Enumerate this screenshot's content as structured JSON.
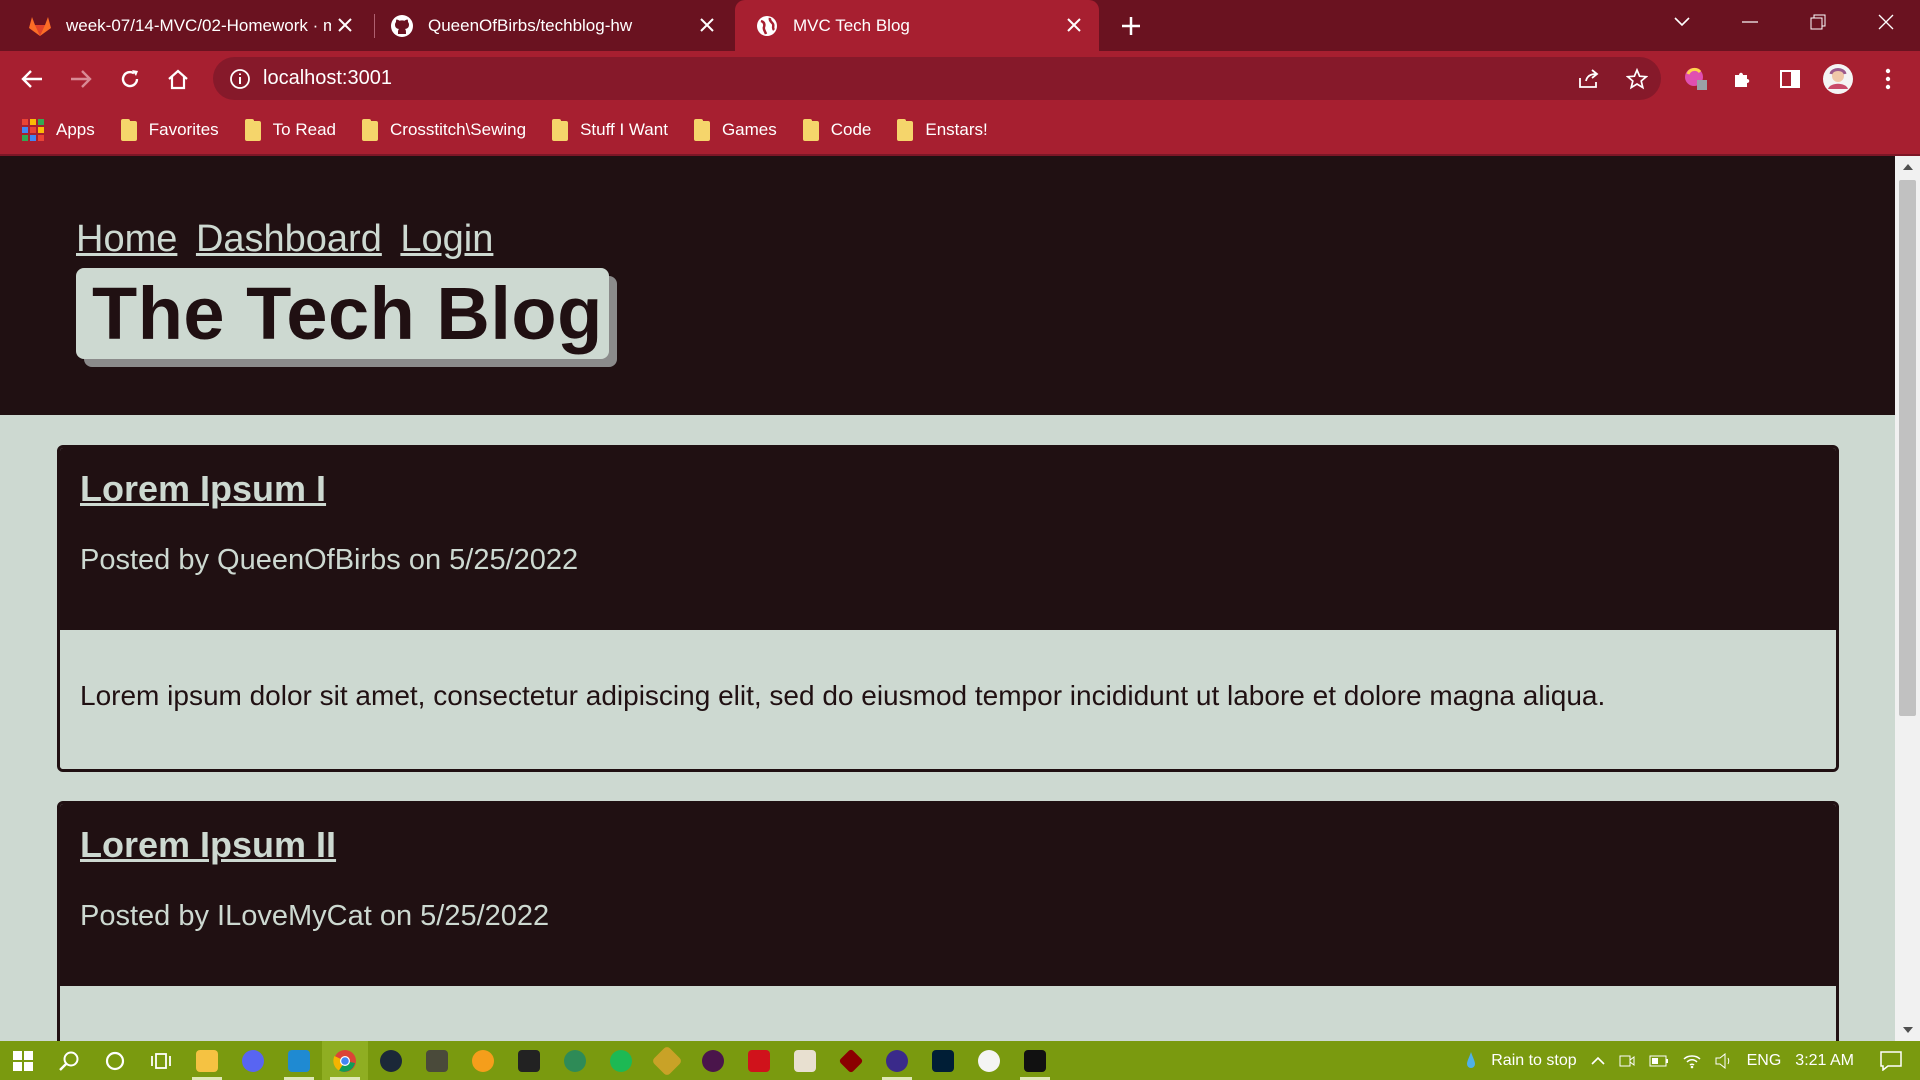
{
  "browser": {
    "tabs": [
      {
        "title": "week-07/14-MVC/02-Homework · m",
        "icon": "gitlab-icon",
        "active": false
      },
      {
        "title": "QueenOfBirbs/techblog-hw",
        "icon": "github-icon",
        "active": false
      },
      {
        "title": "MVC Tech Blog",
        "icon": "globe-icon",
        "active": true
      }
    ],
    "address": "localhost:3001",
    "bookmarks": [
      "Apps",
      "Favorites",
      "To Read",
      "Crosstitch\\Sewing",
      "Stuff I Want",
      "Games",
      "Code",
      "Enstars!"
    ]
  },
  "site": {
    "nav": {
      "home": "Home",
      "dashboard": "Dashboard",
      "login": "Login"
    },
    "brand": "The Tech Blog",
    "posts": [
      {
        "title": "Lorem Ipsum I",
        "meta": "Posted by QueenOfBirbs on 5/25/2022",
        "body": "Lorem ipsum dolor sit amet, consectetur adipiscing elit, sed do eiusmod tempor incididunt ut labore et dolore magna aliqua."
      },
      {
        "title": "Lorem Ipsum II",
        "meta": "Posted by ILoveMyCat on 5/25/2022",
        "body": ""
      }
    ]
  },
  "taskbar": {
    "weather": "Rain to stop",
    "language": "ENG",
    "time": "3:21 AM"
  },
  "colors": {
    "tabbar": "#6a1220",
    "toolbar": "#a71f30",
    "page_dark": "#201012",
    "page_light": "#cdd9d1",
    "taskbar": "#7a9a0f"
  }
}
